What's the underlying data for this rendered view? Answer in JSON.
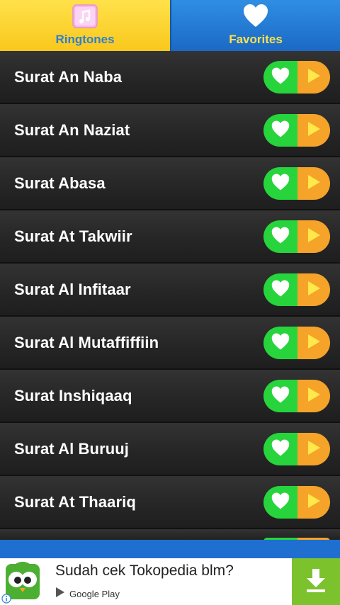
{
  "tabs": {
    "ringtones": {
      "label": "Ringtones",
      "icon": "music-note-icon",
      "active": true
    },
    "favorites": {
      "label": "Favorites",
      "icon": "heart-icon"
    }
  },
  "list": {
    "items": [
      {
        "title": "Surat An Naba"
      },
      {
        "title": "Surat An Naziat"
      },
      {
        "title": "Surat Abasa"
      },
      {
        "title": "Surat At Takwiir"
      },
      {
        "title": "Surat Al Infitaar"
      },
      {
        "title": "Surat Al Mutaffiffiin"
      },
      {
        "title": "Surat Inshiqaaq"
      },
      {
        "title": "Surat Al Buruuj"
      },
      {
        "title": "Surat At Thaariq"
      }
    ]
  },
  "ad": {
    "title": "Sudah cek Tokopedia blm?",
    "store": "Google Play",
    "download_icon": "download-icon",
    "logo_icon": "tokopedia-owl-logo"
  },
  "colors": {
    "tab_active_bg": "#f9c81c",
    "tab_inactive_bg": "#1b69c4",
    "favorite_green": "#27d43c",
    "play_orange": "#f6a32a",
    "ad_download_green": "#7cc22d"
  }
}
